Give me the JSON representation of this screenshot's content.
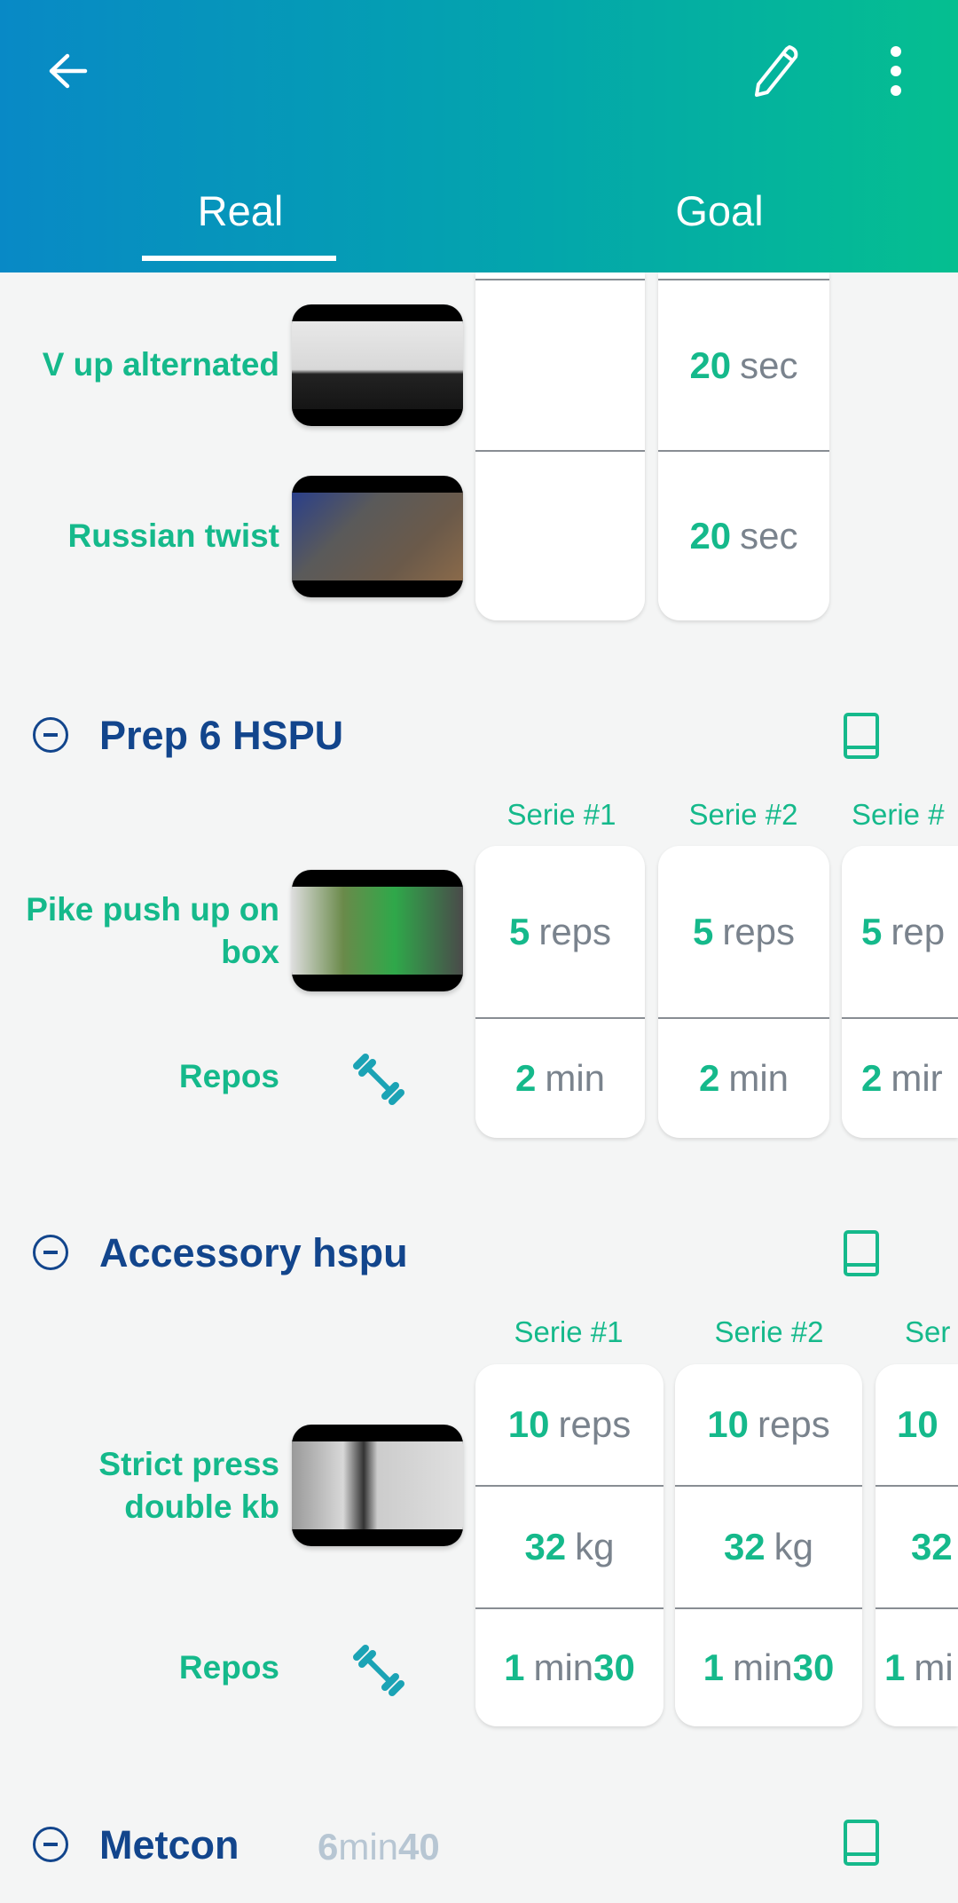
{
  "header": {
    "tabs": [
      {
        "label": "Real",
        "active": true
      },
      {
        "label": "Goal",
        "active": false
      }
    ],
    "icons": [
      "back-arrow-icon",
      "pencil-icon",
      "more-vertical-icon"
    ]
  },
  "colors": {
    "accent": "#15b98b",
    "title": "#12458c",
    "gradient_start": "#0889c6",
    "gradient_end": "#05bf90"
  },
  "section0": {
    "exercises": [
      {
        "name": "V up alternated",
        "col1": "",
        "col2_num": "20",
        "col2_unit": "sec"
      },
      {
        "name": "Russian twist",
        "col1": "",
        "col2_num": "20",
        "col2_unit": "sec"
      }
    ]
  },
  "section1": {
    "title": "Prep 6 HSPU",
    "series": [
      "Serie #1",
      "Serie #2",
      "Serie #"
    ],
    "exercise": "Pike push up on box",
    "reps": [
      {
        "num": "5",
        "unit": "reps"
      },
      {
        "num": "5",
        "unit": "reps"
      },
      {
        "num": "5",
        "unit": "rep"
      }
    ],
    "rest_label": "Repos",
    "rest": [
      {
        "num": "2",
        "unit": "min"
      },
      {
        "num": "2",
        "unit": "min"
      },
      {
        "num": "2",
        "unit": "mir"
      }
    ]
  },
  "section2": {
    "title": "Accessory hspu",
    "series": [
      "Serie #1",
      "Serie #2",
      "Ser"
    ],
    "exercise": "Strict press double kb",
    "reps": [
      {
        "num": "10",
        "unit": "reps"
      },
      {
        "num": "10",
        "unit": "reps"
      },
      {
        "num": "10",
        "unit": ""
      }
    ],
    "weight": [
      {
        "num": "32",
        "unit": "kg"
      },
      {
        "num": "32",
        "unit": "kg"
      },
      {
        "num": "32",
        "unit": ""
      }
    ],
    "rest_label": "Repos",
    "rest": [
      {
        "num": "1",
        "unit": "min",
        "sec": "30"
      },
      {
        "num": "1",
        "unit": "min",
        "sec": "30"
      },
      {
        "num": "1",
        "unit": "mi",
        "sec": ""
      }
    ]
  },
  "section3": {
    "title": "Metcon",
    "duration_min": "6",
    "duration_unit": "min",
    "duration_sec": "40"
  }
}
